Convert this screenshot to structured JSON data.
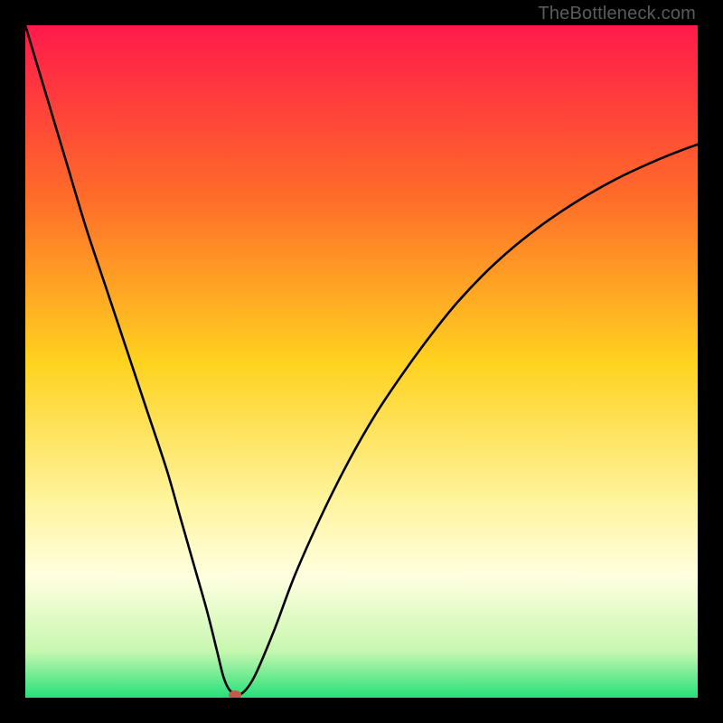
{
  "watermark": "TheBottleneck.com",
  "chart_data": {
    "type": "line",
    "title": "",
    "xlabel": "",
    "ylabel": "",
    "xlim": [
      0,
      100
    ],
    "ylim": [
      0,
      100
    ],
    "gradient_stops": [
      {
        "offset": 0,
        "color": "#ff1a4b"
      },
      {
        "offset": 25,
        "color": "#ff6a2a"
      },
      {
        "offset": 50,
        "color": "#ffd21f"
      },
      {
        "offset": 70,
        "color": "#fff39a"
      },
      {
        "offset": 82,
        "color": "#ffffe0"
      },
      {
        "offset": 93,
        "color": "#c8f7b0"
      },
      {
        "offset": 100,
        "color": "#26e07a"
      }
    ],
    "series": [
      {
        "name": "bottleneck-curve",
        "x": [
          0,
          3,
          6,
          9,
          12,
          15,
          18,
          21,
          23,
          25,
          27,
          28.5,
          29.5,
          30.5,
          32,
          34,
          37,
          40,
          44,
          48,
          52,
          56,
          60,
          64,
          68,
          72,
          76,
          80,
          84,
          88,
          92,
          96,
          100
        ],
        "y": [
          100,
          90,
          80,
          70,
          61,
          52,
          43,
          34,
          27,
          20,
          13,
          7,
          3,
          1,
          0.5,
          3,
          10,
          18,
          27,
          35,
          42,
          48,
          53.5,
          58.5,
          62.8,
          66.5,
          69.7,
          72.5,
          75,
          77.2,
          79.1,
          80.8,
          82.3
        ]
      }
    ],
    "marker": {
      "x": 31.2,
      "y": 0.4,
      "color": "#c45a4a",
      "rx": 7,
      "ry": 5
    }
  }
}
